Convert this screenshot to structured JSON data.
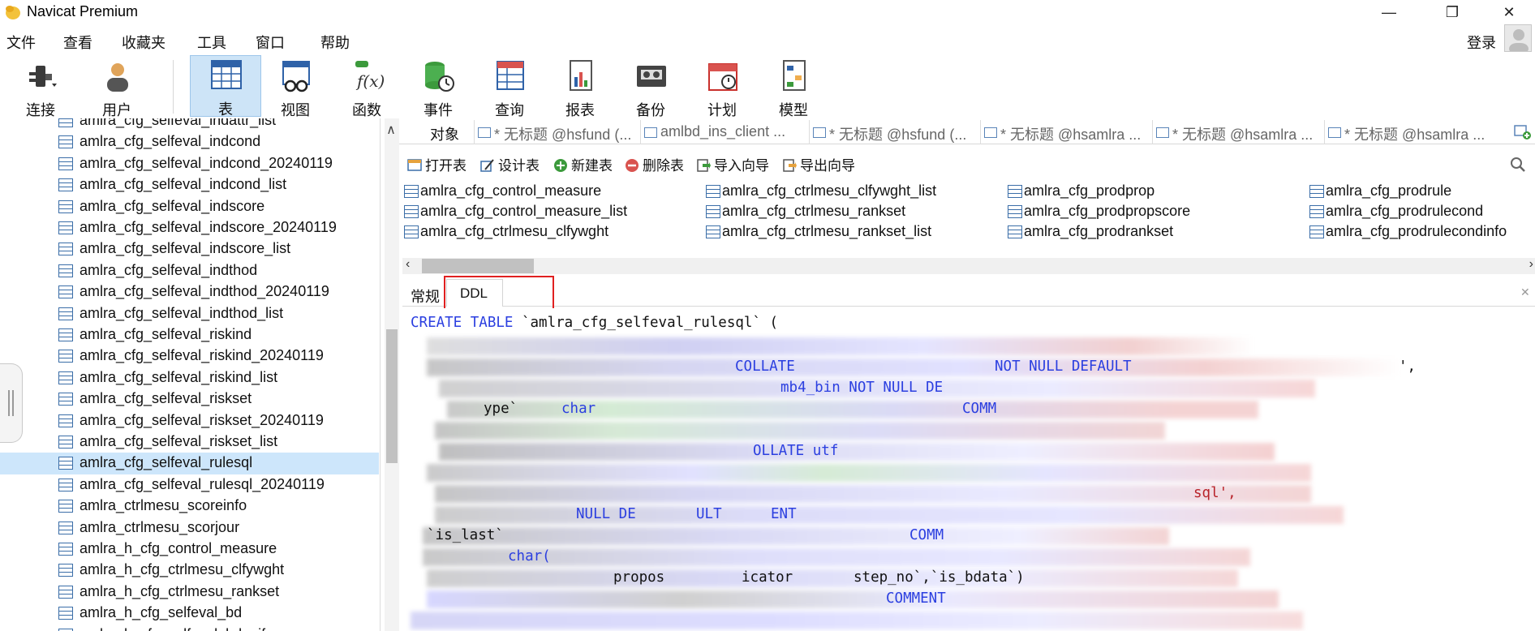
{
  "window": {
    "title": "Navicat Premium",
    "minimize": "—",
    "maximize": "❐",
    "close": "✕"
  },
  "menu": [
    "文件",
    "查看",
    "收藏夹",
    "工具",
    "窗口",
    "帮助"
  ],
  "login_label": "登录",
  "toolbar": [
    {
      "label": "连接",
      "icon": "connection-icon"
    },
    {
      "label": "用户",
      "icon": "user-icon"
    },
    {
      "label": "表",
      "icon": "table-icon",
      "active": true
    },
    {
      "label": "视图",
      "icon": "view-icon"
    },
    {
      "label": "函数",
      "icon": "function-icon"
    },
    {
      "label": "事件",
      "icon": "event-icon"
    },
    {
      "label": "查询",
      "icon": "query-icon"
    },
    {
      "label": "报表",
      "icon": "report-icon"
    },
    {
      "label": "备份",
      "icon": "backup-icon"
    },
    {
      "label": "计划",
      "icon": "schedule-icon"
    },
    {
      "label": "模型",
      "icon": "model-icon"
    }
  ],
  "tree": {
    "items": [
      "amlra_cfg_selfeval_indattr_list",
      "amlra_cfg_selfeval_indcond",
      "amlra_cfg_selfeval_indcond_20240119",
      "amlra_cfg_selfeval_indcond_list",
      "amlra_cfg_selfeval_indscore",
      "amlra_cfg_selfeval_indscore_20240119",
      "amlra_cfg_selfeval_indscore_list",
      "amlra_cfg_selfeval_indthod",
      "amlra_cfg_selfeval_indthod_20240119",
      "amlra_cfg_selfeval_indthod_list",
      "amlra_cfg_selfeval_riskind",
      "amlra_cfg_selfeval_riskind_20240119",
      "amlra_cfg_selfeval_riskind_list",
      "amlra_cfg_selfeval_riskset",
      "amlra_cfg_selfeval_riskset_20240119",
      "amlra_cfg_selfeval_riskset_list",
      "amlra_cfg_selfeval_rulesql",
      "amlra_cfg_selfeval_rulesql_20240119",
      "amlra_ctrlmesu_scoreinfo",
      "amlra_ctrlmesu_scorjour",
      "amlra_h_cfg_control_measure",
      "amlra_h_cfg_ctrlmesu_clfywght",
      "amlra_h_cfg_ctrlmesu_rankset",
      "amlra_h_cfg_selfeval_bd",
      "amlra_h_cfg_selfeval_bd_nif"
    ],
    "selected": "amlra_cfg_selfeval_rulesql"
  },
  "tabs": [
    {
      "label": "对象"
    },
    {
      "label": "* 无标题 @hsfund (..."
    },
    {
      "label": "amlbd_ins_client ..."
    },
    {
      "label": "* 无标题 @hsfund (..."
    },
    {
      "label": "* 无标题 @hsamlra ..."
    },
    {
      "label": "* 无标题 @hsamlra ..."
    },
    {
      "label": "* 无标题 @hsamlra ..."
    }
  ],
  "object_toolbar": [
    "打开表",
    "设计表",
    "新建表",
    "删除表",
    "导入向导",
    "导出向导"
  ],
  "objects": [
    [
      "amlra_cfg_control_measure",
      "amlra_cfg_control_measure_list",
      "amlra_cfg_ctrlmesu_clfywght"
    ],
    [
      "amlra_cfg_ctrlmesu_clfywght_list",
      "amlra_cfg_ctrlmesu_rankset",
      "amlra_cfg_ctrlmesu_rankset_list"
    ],
    [
      "amlra_cfg_prodprop",
      "amlra_cfg_prodpropscore",
      "amlra_cfg_prodrankset"
    ],
    [
      "amlra_cfg_prodrule",
      "amlra_cfg_prodrulecond",
      "amlra_cfg_prodrulecondinfo"
    ]
  ],
  "info_tabs": {
    "general": "常规",
    "ddl": "DDL"
  },
  "ddl": {
    "line1_kw": "CREATE TABLE",
    "line1_name": " `amlra_cfg_selfeval_rulesql` (",
    "fragments": [
      {
        "text": "COLLATE",
        "kind": "kw"
      },
      {
        "text": "NOT NULL DEFAULT",
        "kind": "kw"
      },
      {
        "text": "',",
        "kind": "plain"
      },
      {
        "text": "mb4_bin NOT NULL DE",
        "kind": "kw"
      },
      {
        "text": "ype`",
        "kind": "plain"
      },
      {
        "text": "char",
        "kind": "kw"
      },
      {
        "text": "COMM",
        "kind": "kw"
      },
      {
        "text": "OLLATE utf",
        "kind": "kw"
      },
      {
        "text": "sql',",
        "kind": "str"
      },
      {
        "text": "NULL DE",
        "kind": "kw"
      },
      {
        "text": "ULT",
        "kind": "kw"
      },
      {
        "text": "ENT",
        "kind": "kw"
      },
      {
        "text": "`is_last`",
        "kind": "plain"
      },
      {
        "text": "COMM",
        "kind": "kw"
      },
      {
        "text": "char(",
        "kind": "kw"
      },
      {
        "text": "propos",
        "kind": "plain"
      },
      {
        "text": "icator",
        "kind": "plain"
      },
      {
        "text": "step_no`,`is_bdata`)",
        "kind": "plain"
      },
      {
        "text": "COMMENT",
        "kind": "kw"
      }
    ]
  },
  "colors": {
    "accent": "#cde4f7",
    "selected_row": "#cde6fb",
    "keyword": "#2b3fe0",
    "string": "#b8232a",
    "highlight": "#e02020"
  }
}
